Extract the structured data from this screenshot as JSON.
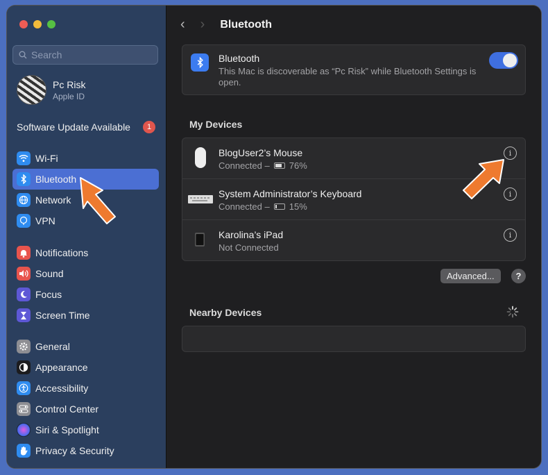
{
  "sidebar": {
    "search_placeholder": "Search",
    "profile": {
      "name": "Pc Risk",
      "subtitle": "Apple ID"
    },
    "update": {
      "label": "Software Update Available",
      "count": "1"
    },
    "groups": [
      [
        {
          "label": "Wi-Fi",
          "icon": "wifi-icon",
          "color": "#2f8cf0"
        },
        {
          "label": "Bluetooth",
          "icon": "bluetooth-icon",
          "color": "#2f8cf0",
          "active": true
        },
        {
          "label": "Network",
          "icon": "globe-icon",
          "color": "#2f8cf0"
        },
        {
          "label": "VPN",
          "icon": "vpn-icon",
          "color": "#2f8cf0"
        }
      ],
      [
        {
          "label": "Notifications",
          "icon": "bell-icon",
          "color": "#e8544d"
        },
        {
          "label": "Sound",
          "icon": "speaker-icon",
          "color": "#e8544d"
        },
        {
          "label": "Focus",
          "icon": "moon-icon",
          "color": "#5e58d6"
        },
        {
          "label": "Screen Time",
          "icon": "hourglass-icon",
          "color": "#5e58d6"
        }
      ],
      [
        {
          "label": "General",
          "icon": "gear-icon",
          "color": "#8e8e93"
        },
        {
          "label": "Appearance",
          "icon": "appearance-icon",
          "color": "#1c1c1e"
        },
        {
          "label": "Accessibility",
          "icon": "accessibility-icon",
          "color": "#2f8cf0"
        },
        {
          "label": "Control Center",
          "icon": "control-center-icon",
          "color": "#8e8e93"
        },
        {
          "label": "Siri & Spotlight",
          "icon": "siri-icon",
          "color": "#7b4fd6"
        },
        {
          "label": "Privacy & Security",
          "icon": "hand-icon",
          "color": "#2f8cf0"
        }
      ]
    ]
  },
  "main": {
    "title": "Bluetooth",
    "bluetooth": {
      "title": "Bluetooth",
      "description": "This Mac is discoverable as “Pc Risk” while Bluetooth Settings is open.",
      "enabled": true
    },
    "my_devices_label": "My Devices",
    "devices": [
      {
        "name": "BlogUser2’s Mouse",
        "status": "Connected –",
        "battery": "76%",
        "battery_level": 0.76,
        "icon": "mouse-icon"
      },
      {
        "name": "System Administrator’s Keyboard",
        "status": "Connected –",
        "battery": "15%",
        "battery_level": 0.15,
        "icon": "keyboard-icon"
      },
      {
        "name": "Karolina’s iPad",
        "status": "Not Connected",
        "battery": "",
        "icon": "ipad-icon"
      }
    ],
    "advanced_label": "Advanced...",
    "help_label": "?",
    "nearby_label": "Nearby Devices"
  }
}
